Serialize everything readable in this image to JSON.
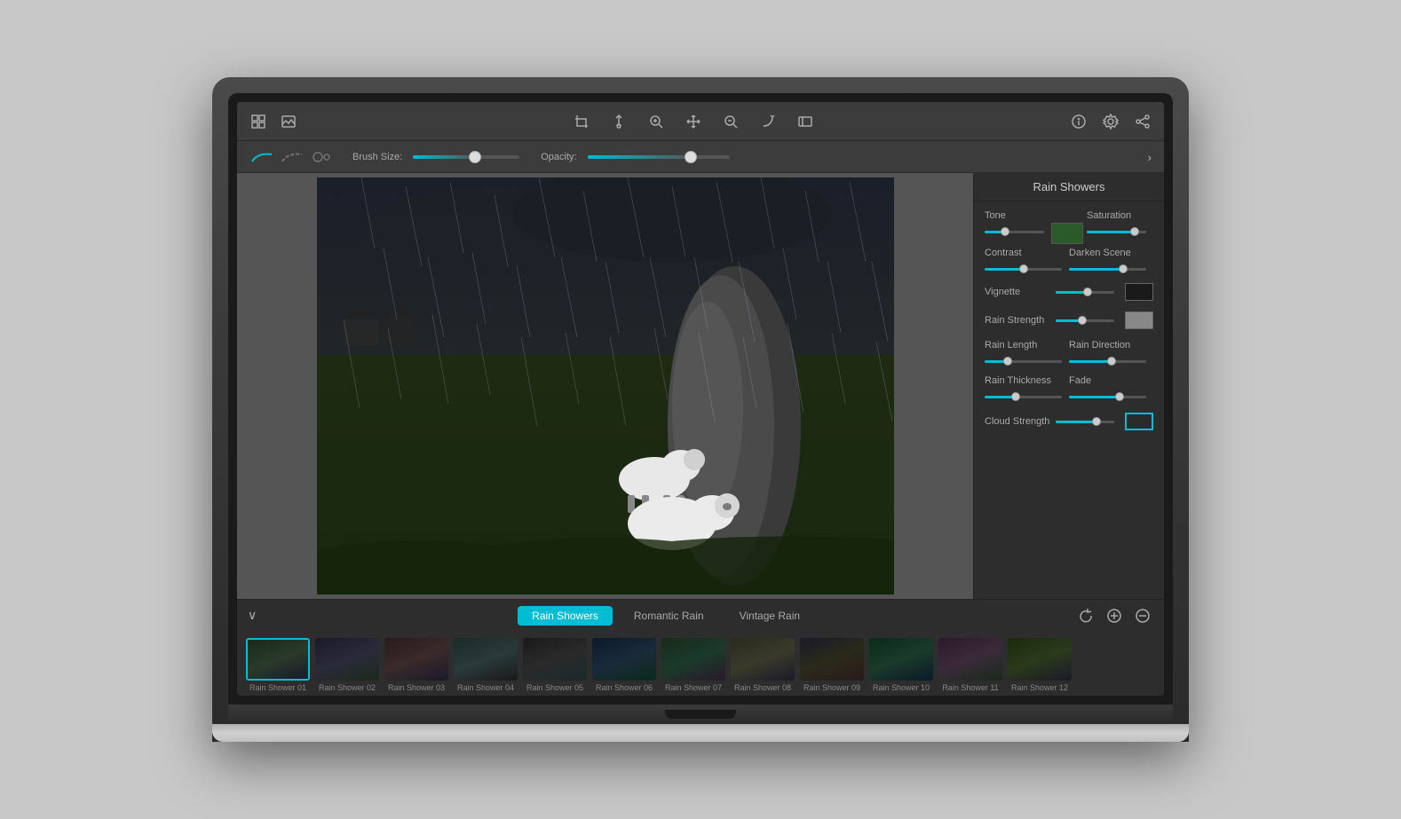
{
  "app": {
    "title": "Rain Showers"
  },
  "toolbar": {
    "icons": [
      "grid-icon",
      "photo-icon",
      "crop-icon",
      "pin-icon",
      "zoom-in-icon",
      "move-icon",
      "zoom-out-icon",
      "redo-icon",
      "fullscreen-icon"
    ],
    "right_icons": [
      "info-icon",
      "settings-icon",
      "share-icon"
    ]
  },
  "brush_toolbar": {
    "size_label": "Brush Size:",
    "opacity_label": "Opacity:",
    "size_value": 50,
    "opacity_value": 75
  },
  "right_panel": {
    "title": "Rain Showers",
    "controls": {
      "tone_label": "Tone",
      "saturation_label": "Saturation",
      "contrast_label": "Contrast",
      "darken_scene_label": "Darken Scene",
      "vignette_label": "Vignette",
      "rain_strength_label": "Rain Strength",
      "rain_length_label": "Rain Length",
      "rain_direction_label": "Rain Direction",
      "rain_thickness_label": "Rain Thickness",
      "fade_label": "Fade",
      "cloud_strength_label": "Cloud Strength",
      "tone_value": 35,
      "saturation_value": 80,
      "contrast_value": 50,
      "darken_scene_value": 70,
      "vignette_value": 55,
      "rain_strength_value": 45,
      "rain_length_value": 30,
      "rain_direction_value": 55,
      "rain_thickness_value": 40,
      "fade_value": 65,
      "cloud_strength_value": 70
    }
  },
  "bottom_tabs": [
    {
      "label": "Rain Showers",
      "active": true
    },
    {
      "label": "Romantic Rain",
      "active": false
    },
    {
      "label": "Vintage Rain",
      "active": false
    }
  ],
  "thumbnails": [
    {
      "label": "Rain Shower 01",
      "selected": true
    },
    {
      "label": "Rain Shower 02",
      "selected": false
    },
    {
      "label": "Rain Shower 03",
      "selected": false
    },
    {
      "label": "Rain Shower 04",
      "selected": false
    },
    {
      "label": "Rain Shower 05",
      "selected": false
    },
    {
      "label": "Rain Shower 06",
      "selected": false
    },
    {
      "label": "Rain Shower 07",
      "selected": false
    },
    {
      "label": "Rain Shower 08",
      "selected": false
    },
    {
      "label": "Rain Shower 09",
      "selected": false
    },
    {
      "label": "Rain Shower 10",
      "selected": false
    },
    {
      "label": "Rain Shower 11",
      "selected": false
    },
    {
      "label": "Rain Shower 12",
      "selected": false
    }
  ],
  "colors": {
    "accent": "#00bcd4",
    "panel_bg": "#2d2d2d",
    "toolbar_bg": "#3c3c3c",
    "swatch_dark": "#1a1a1a",
    "swatch_gray": "#888888"
  }
}
